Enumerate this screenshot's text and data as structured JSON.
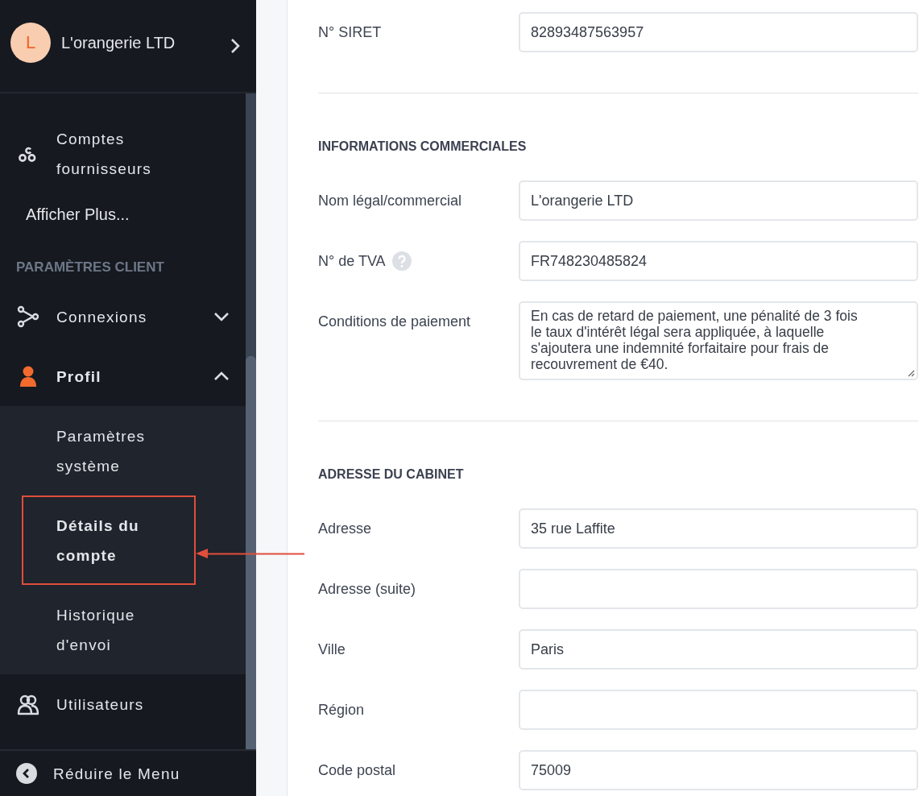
{
  "sidebar": {
    "account": {
      "initial": "L",
      "name": "L'orangerie LTD"
    },
    "items": [
      {
        "kind": "item",
        "label": "Comptes fournisseurs"
      },
      {
        "kind": "more",
        "label": "Afficher Plus..."
      },
      {
        "kind": "section",
        "label": "PARAMÈTRES CLIENT"
      },
      {
        "kind": "group",
        "label": "Connexions",
        "expanded": false
      },
      {
        "kind": "group",
        "label": "Profil",
        "expanded": true,
        "children": [
          {
            "label": "Paramètres système",
            "selected": false
          },
          {
            "label": "Détails du compte",
            "selected": true
          },
          {
            "label": "Historique d'envoi",
            "selected": false
          }
        ]
      },
      {
        "kind": "item",
        "label": "Utilisateurs"
      }
    ],
    "collapse": {
      "label": "Réduire le Menu"
    }
  },
  "form": {
    "sections": [
      {
        "fields": [
          {
            "kind": "input",
            "label": "N° SIRET",
            "value": "82893487563957"
          }
        ]
      },
      {
        "title": "INFORMATIONS COMMERCIALES",
        "fields": [
          {
            "kind": "input",
            "label": "Nom légal/commercial",
            "value": "L'orangerie LTD"
          },
          {
            "kind": "input",
            "label": "N° de TVA",
            "help": true,
            "value": "FR748230485824"
          },
          {
            "kind": "textarea",
            "label": "Conditions de paiement",
            "value": "En cas de retard de paiement, une pénalité de 3 fois le taux d'intérêt légal sera appliquée, à laquelle s'ajoutera une indemnité forfaitaire pour frais de recouvrement de €40."
          }
        ]
      },
      {
        "title": "ADRESSE DU CABINET",
        "fields": [
          {
            "kind": "input",
            "label": "Adresse",
            "value": "35 rue Laffite"
          },
          {
            "kind": "input",
            "label": "Adresse (suite)"
          },
          {
            "kind": "input",
            "label": "Ville",
            "value": "Paris"
          },
          {
            "kind": "input",
            "label": "Région"
          },
          {
            "kind": "input",
            "label": "Code postal",
            "value": "75009"
          }
        ]
      }
    ]
  }
}
